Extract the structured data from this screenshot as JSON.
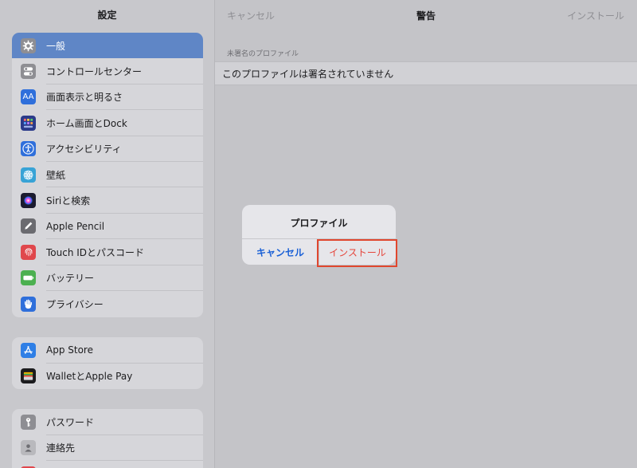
{
  "sidebar": {
    "title": "設定",
    "groups": [
      {
        "items": [
          {
            "label": "一般",
            "icon": "gear-icon",
            "selected": true
          },
          {
            "label": "コントロールセンター",
            "icon": "control-center-icon"
          },
          {
            "label": "画面表示と明るさ",
            "icon": "display-brightness-icon",
            "icon_text": "AA"
          },
          {
            "label": "ホーム画面とDock",
            "icon": "home-screen-icon"
          },
          {
            "label": "アクセシビリティ",
            "icon": "accessibility-icon"
          },
          {
            "label": "壁紙",
            "icon": "wallpaper-icon"
          },
          {
            "label": "Siriと検索",
            "icon": "siri-icon"
          },
          {
            "label": "Apple Pencil",
            "icon": "pencil-icon"
          },
          {
            "label": "Touch IDとパスコード",
            "icon": "fingerprint-icon"
          },
          {
            "label": "バッテリー",
            "icon": "battery-icon"
          },
          {
            "label": "プライバシー",
            "icon": "hand-icon"
          }
        ]
      },
      {
        "items": [
          {
            "label": "App Store",
            "icon": "app-store-icon"
          },
          {
            "label": "WalletとApple Pay",
            "icon": "wallet-icon"
          }
        ]
      },
      {
        "items": [
          {
            "label": "パスワード",
            "icon": "key-icon"
          },
          {
            "label": "連絡先",
            "icon": "contacts-icon"
          },
          {
            "label": "",
            "icon": "app-icon"
          }
        ]
      }
    ]
  },
  "detail": {
    "nav": {
      "cancel": "キャンセル",
      "title": "警告",
      "install": "インストール"
    },
    "section_header": "未署名のプロファイル",
    "row_text": "このプロファイルは署名されていません"
  },
  "alert": {
    "title": "プロファイル",
    "cancel": "キャンセル",
    "install": "インストール"
  },
  "colors": {
    "selected_row": "#5f86c6",
    "link_blue": "#1a60d6",
    "destructive_red": "#e5453b",
    "highlight": "#e0472f"
  }
}
